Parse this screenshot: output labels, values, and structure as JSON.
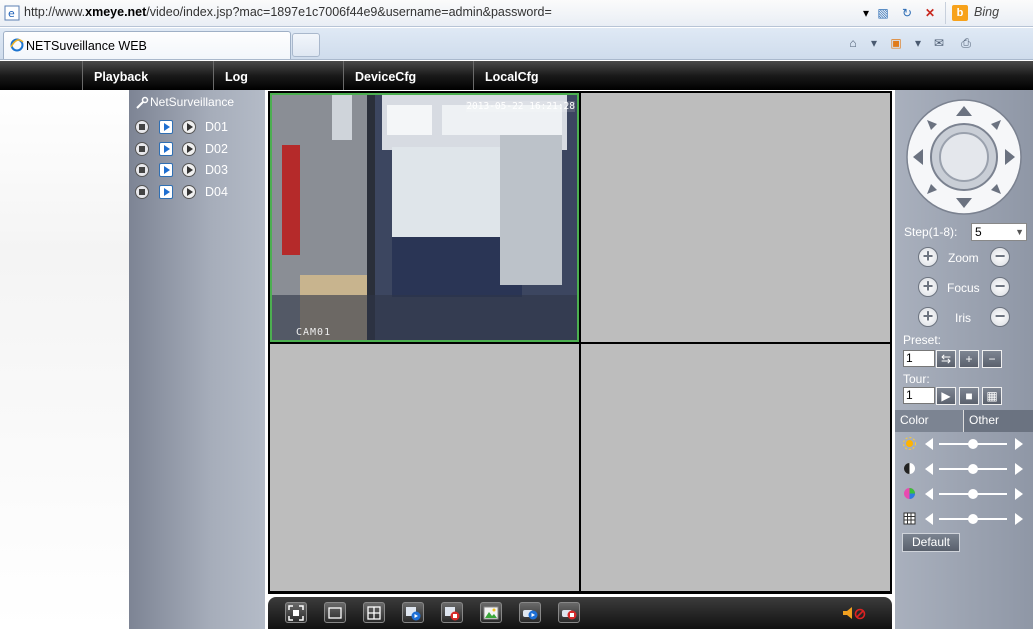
{
  "browser": {
    "url_prefix": "http://www.",
    "url_domain": "xmeye.net",
    "url_rest": "/video/index.jsp?mac=1897e1c7006f44e9&username=admin&password=",
    "search_engine": "Bing",
    "tab_title": "NETSuveillance WEB"
  },
  "menu": {
    "items": [
      "Playback",
      "Log",
      "DeviceCfg",
      "LocalCfg"
    ]
  },
  "tree": {
    "root": "NetSurveillance",
    "channels": [
      "D01",
      "D02",
      "D03",
      "D04"
    ]
  },
  "video": {
    "cell1_timestamp": "2013-05-22 16:21:28",
    "cell1_camera": "CAM01"
  },
  "ptz": {
    "step_label": "Step(1-8):",
    "step_value": "5",
    "zoom_label": "Zoom",
    "focus_label": "Focus",
    "iris_label": "Iris",
    "preset_label": "Preset:",
    "preset_value": "1",
    "tour_label": "Tour:",
    "tour_value": "1"
  },
  "color_panel": {
    "tab_color": "Color",
    "tab_other": "Other",
    "sliders": [
      0.5,
      0.5,
      0.5,
      0.5
    ],
    "default_label": "Default"
  },
  "colors": {
    "menu_bg": "#000000",
    "selected_border": "#4caf50",
    "panel_bg": "#8f97a6"
  }
}
